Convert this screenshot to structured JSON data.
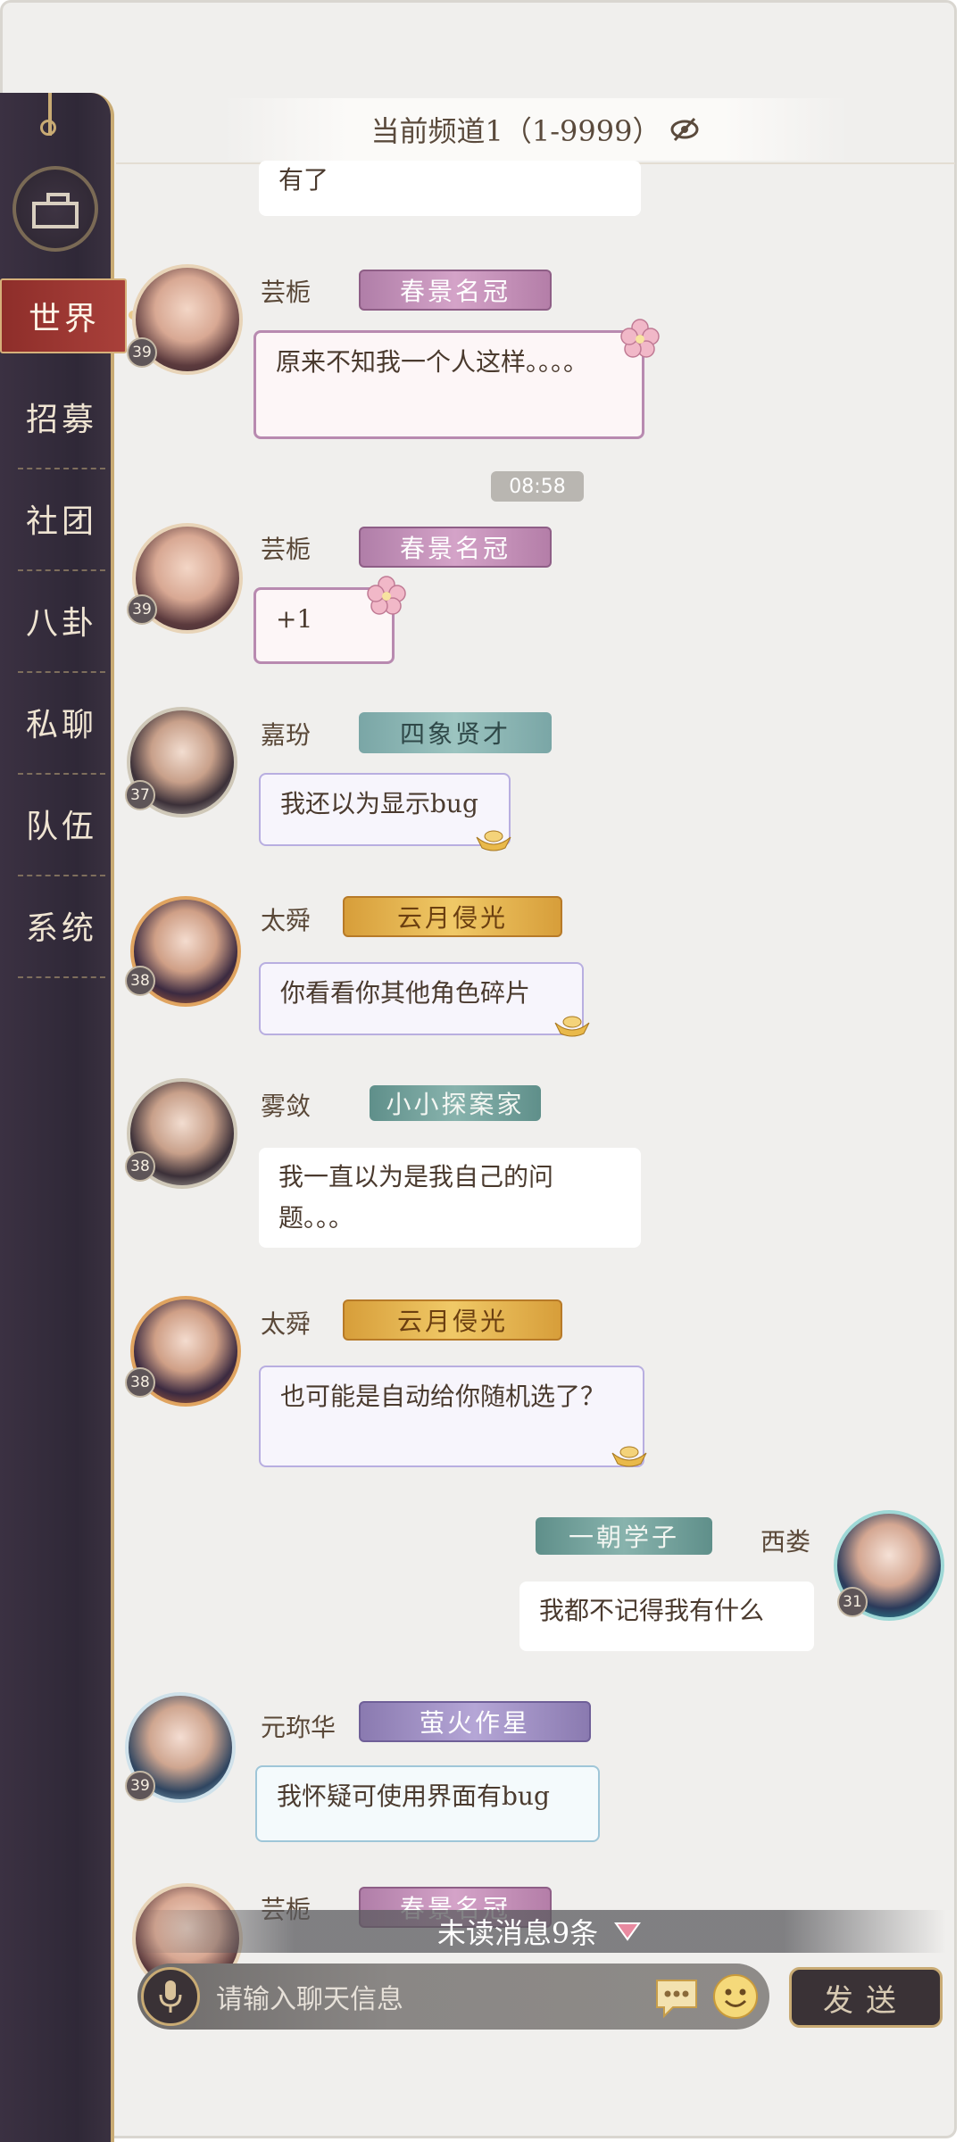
{
  "header": {
    "channel_title": "当前频道1（1-9999）"
  },
  "nav": {
    "items": [
      {
        "label": "世界",
        "active": true
      },
      {
        "label": "招募"
      },
      {
        "label": "社团"
      },
      {
        "label": "八卦"
      },
      {
        "label": "私聊"
      },
      {
        "label": "队伍"
      },
      {
        "label": "系统"
      }
    ]
  },
  "messages": {
    "m0": {
      "text": "有了"
    },
    "m1": {
      "name": "芸栀",
      "level": "39",
      "badge": "春景名冠",
      "text": "原来不知我一个人这样。。。。"
    },
    "time": "08:58",
    "m2": {
      "name": "芸栀",
      "level": "39",
      "badge": "春景名冠",
      "text": "+1"
    },
    "m3": {
      "name": "嘉玢",
      "level": "37",
      "badge": "四象贤才",
      "text": "我还以为显示bug"
    },
    "m4": {
      "name": "太舜",
      "level": "38",
      "badge": "云月侵光",
      "text": "你看看你其他角色碎片"
    },
    "m5": {
      "name": "雾敛",
      "level": "38",
      "badge": "小小探案家",
      "text": "我一直以为是我自己的问题。。。"
    },
    "m6": {
      "name": "太舜",
      "level": "38",
      "badge": "云月侵光",
      "text": "也可能是自动给你随机选了？"
    },
    "m7": {
      "name": "西娄",
      "level": "31",
      "badge": "一朝学子",
      "text": "我都不记得我有什么"
    },
    "m8": {
      "name": "元珎华",
      "level": "39",
      "badge": "萤火作星",
      "text": "我怀疑可使用界面有bug"
    },
    "m9": {
      "name": "芸栀",
      "badge": "春景名冠"
    }
  },
  "unread": {
    "label": "未读消息9条"
  },
  "input": {
    "placeholder": "请输入聊天信息",
    "send_label": "发送"
  },
  "colors": {
    "accent_gold": "#c9ab74",
    "nav_bg": "#2f2837",
    "active_tab": "#a9403a"
  }
}
